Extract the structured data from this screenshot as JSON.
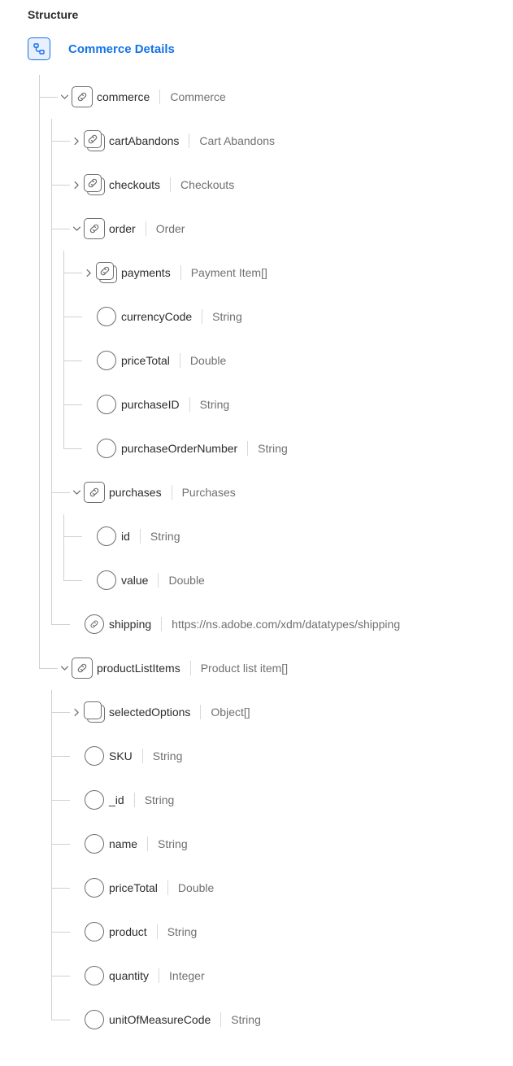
{
  "heading": "Structure",
  "root": {
    "title": "Commerce Details"
  },
  "tree": {
    "commerce": {
      "name": "commerce",
      "type": "Commerce",
      "children": {
        "cartAbandons": {
          "name": "cartAbandons",
          "type": "Cart Abandons"
        },
        "checkouts": {
          "name": "checkouts",
          "type": "Checkouts"
        },
        "order": {
          "name": "order",
          "type": "Order",
          "children": {
            "payments": {
              "name": "payments",
              "type": "Payment Item[]"
            },
            "currencyCode": {
              "name": "currencyCode",
              "type": "String"
            },
            "priceTotal": {
              "name": "priceTotal",
              "type": "Double"
            },
            "purchaseID": {
              "name": "purchaseID",
              "type": "String"
            },
            "purchaseOrderNumber": {
              "name": "purchaseOrderNumber",
              "type": "String"
            }
          }
        },
        "purchases": {
          "name": "purchases",
          "type": "Purchases",
          "children": {
            "id": {
              "name": "id",
              "type": "String"
            },
            "value": {
              "name": "value",
              "type": "Double"
            }
          }
        },
        "shipping": {
          "name": "shipping",
          "type": "https://ns.adobe.com/xdm/datatypes/shipping"
        }
      }
    },
    "productListItems": {
      "name": "productListItems",
      "type": "Product list item[]",
      "children": {
        "selectedOptions": {
          "name": "selectedOptions",
          "type": "Object[]"
        },
        "SKU": {
          "name": "SKU",
          "type": "String"
        },
        "_id": {
          "name": "_id",
          "type": "String"
        },
        "name": {
          "name": "name",
          "type": "String"
        },
        "priceTotal": {
          "name": "priceTotal",
          "type": "Double"
        },
        "product": {
          "name": "product",
          "type": "String"
        },
        "quantity": {
          "name": "quantity",
          "type": "Integer"
        },
        "unitOfMeasureCode": {
          "name": "unitOfMeasureCode",
          "type": "String"
        }
      }
    }
  }
}
